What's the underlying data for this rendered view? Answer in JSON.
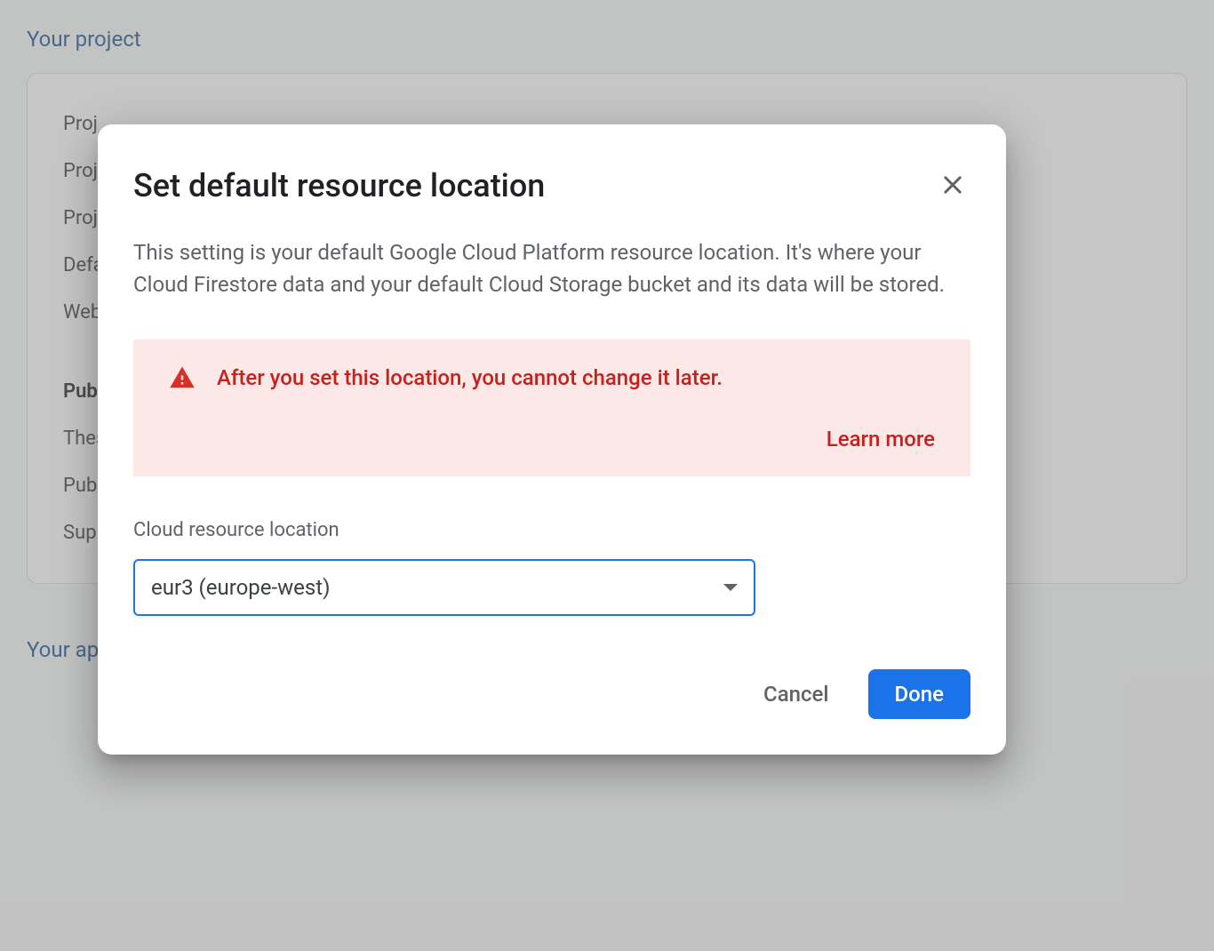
{
  "background": {
    "section1_title": "Your project",
    "section2_title": "Your apps",
    "rows": [
      "Proj",
      "Proj",
      "Proj",
      "Defa",
      "Web"
    ],
    "bold_row": "Pub",
    "rows2": [
      "Thes",
      "Pub",
      "Sup"
    ]
  },
  "dialog": {
    "title": "Set default resource location",
    "description": "This setting is your default Google Cloud Platform resource location. It's where your Cloud Firestore data and your default Cloud Storage bucket and its data will be stored.",
    "warning_text": "After you set this location, you cannot change it later.",
    "learn_more": "Learn more",
    "field_label": "Cloud resource location",
    "select_value": "eur3 (europe-west)",
    "cancel": "Cancel",
    "done": "Done"
  }
}
